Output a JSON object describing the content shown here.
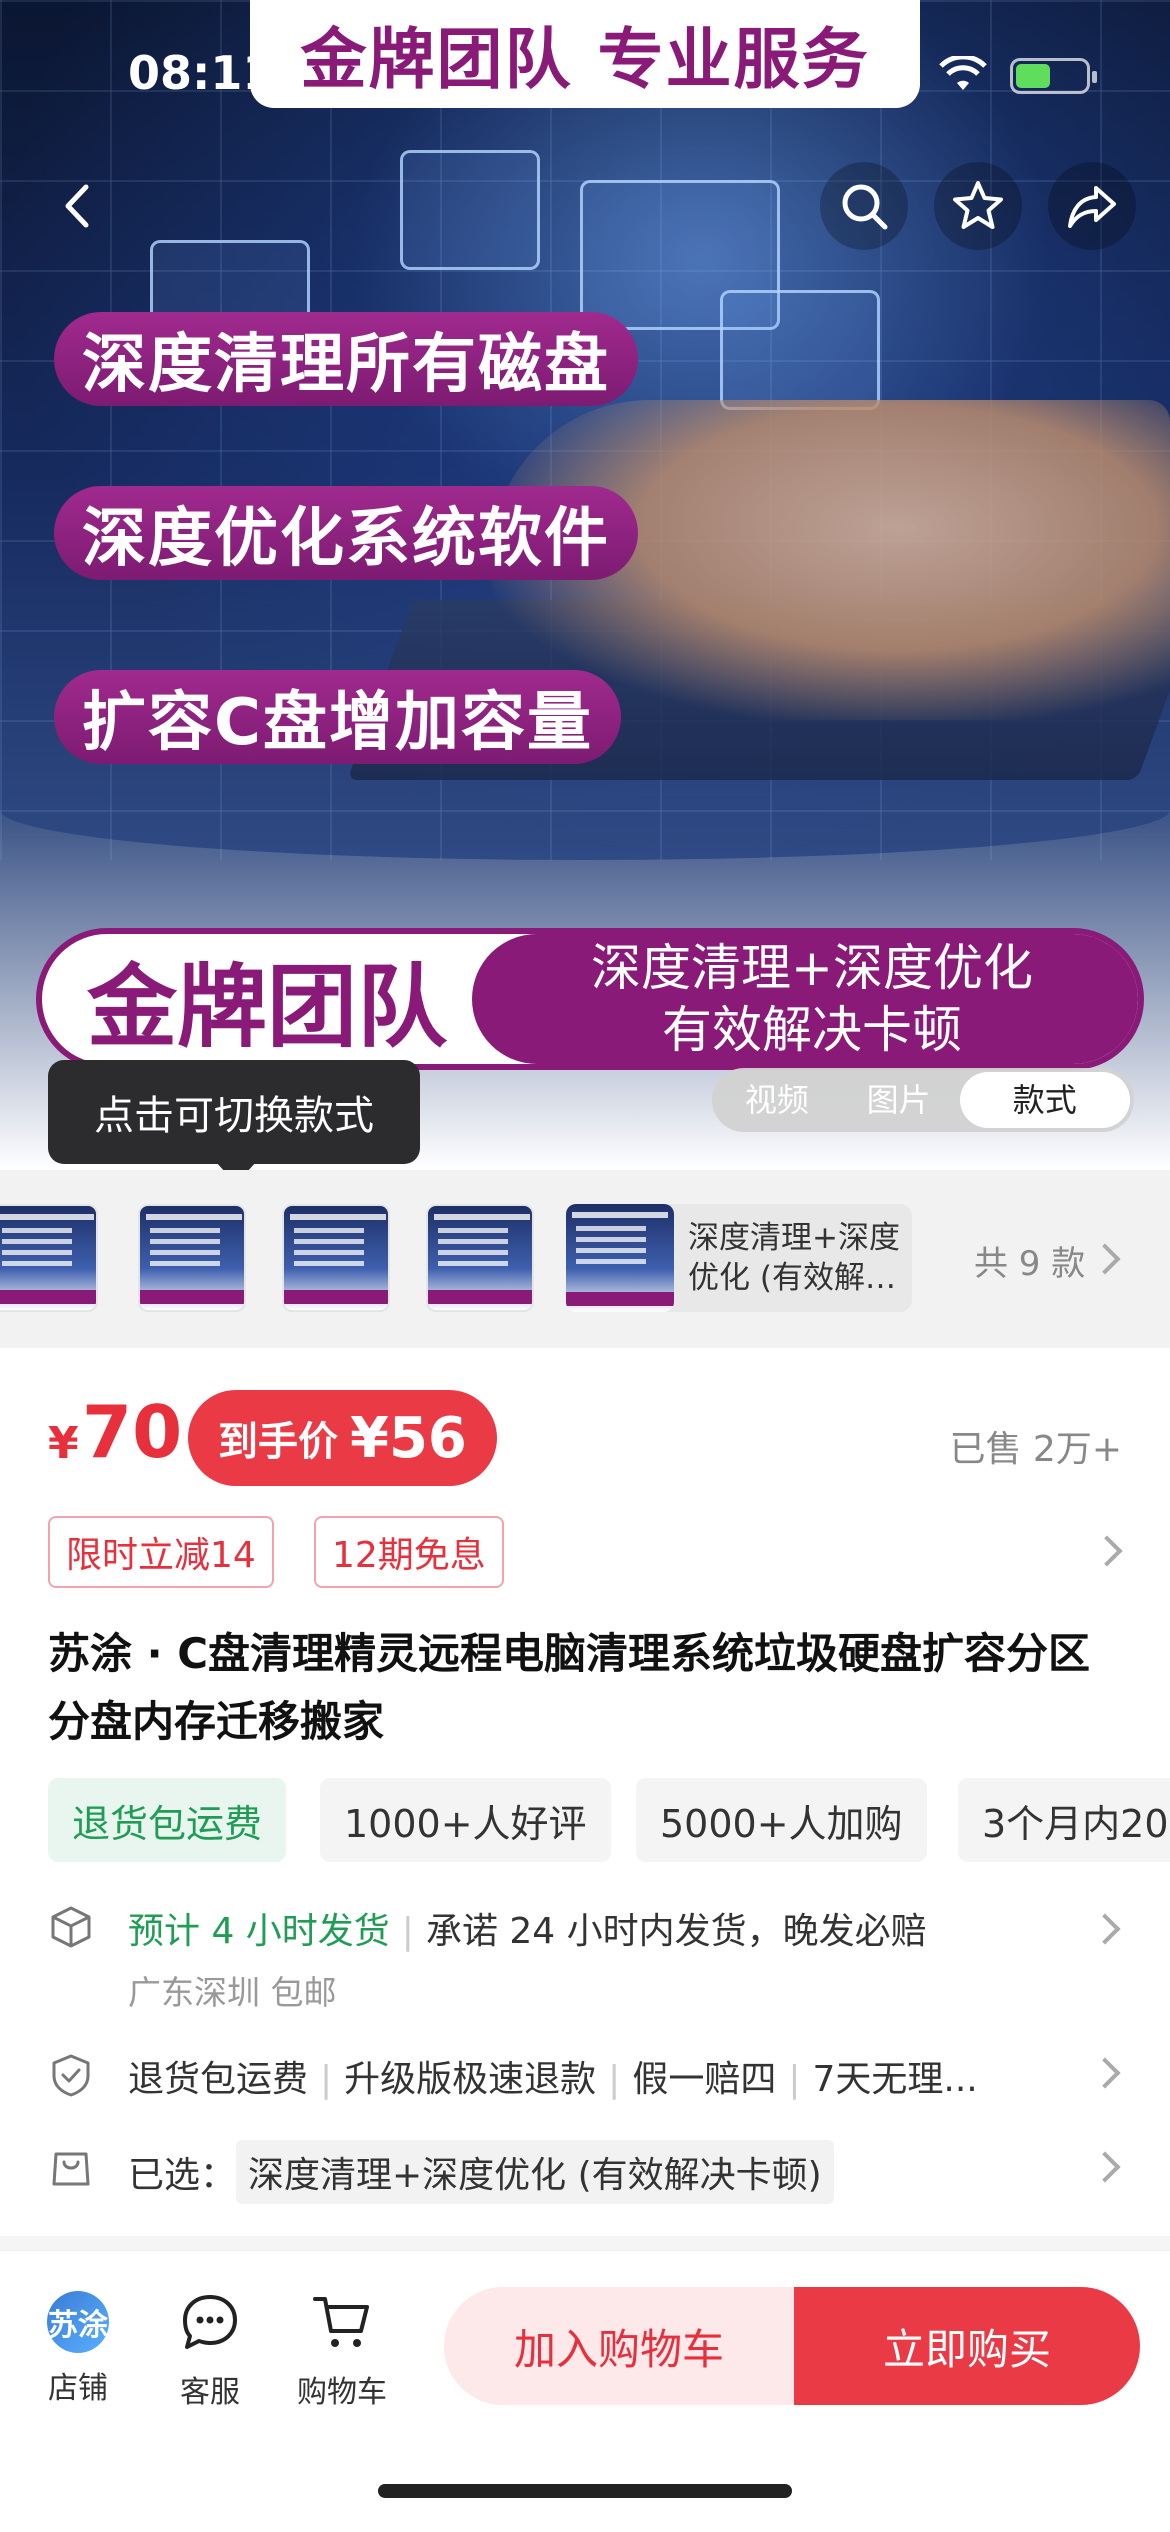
{
  "status_bar": {
    "time": "08:11"
  },
  "hero": {
    "top_banner": "金牌团队 专业服务",
    "pills": [
      "深度清理所有磁盘",
      "深度优化系统软件",
      "扩容C盘增加容量"
    ],
    "brand_left": "金牌团队",
    "brand_right_line1": "深度清理+深度优化",
    "brand_right_line2": "有效解决卡顿"
  },
  "nav_icons": [
    "back-icon",
    "search-icon",
    "star-icon",
    "share-icon"
  ],
  "media_switch": {
    "options": [
      "视频",
      "图片",
      "款式"
    ],
    "active": "款式"
  },
  "tooltip": "点击可切换款式",
  "variants": {
    "selected_label": "深度清理+深度优化 (有效解决卡顿)",
    "count_label": "共 9 款"
  },
  "price": {
    "currency": "¥",
    "value": "70",
    "final_label": "到手价",
    "final_amount": "¥56",
    "sold": "已售 2万+"
  },
  "coupons": [
    "限时立减14",
    "12期免息"
  ],
  "title": "苏涂 · C盘清理精灵远程电脑清理系统垃圾硬盘扩容分区分盘内存迁移搬家",
  "tags": [
    "退货包运费",
    "1000+人好评",
    "5000+人加购",
    "3个月内20"
  ],
  "shipping": {
    "eta": "预计 4 小时发货",
    "promise": "承诺 24 小时内发货，晚发必赔",
    "origin": "广东深圳 包邮"
  },
  "guarantees": [
    "退货包运费",
    "升级版极速退款",
    "假一赔四",
    "7天无理..."
  ],
  "selected": {
    "label": "已选：",
    "value": "深度清理+深度优化 (有效解决卡顿)"
  },
  "bottom_bar": {
    "store_avatar_text": "苏涂",
    "store": "店铺",
    "service": "客服",
    "cart": "购物车",
    "add_to_cart": "加入购物车",
    "buy_now": "立即购买"
  },
  "colors": {
    "accent": "#ea3a45",
    "brand_purple": "#8a1a78",
    "green": "#1f9d55"
  }
}
